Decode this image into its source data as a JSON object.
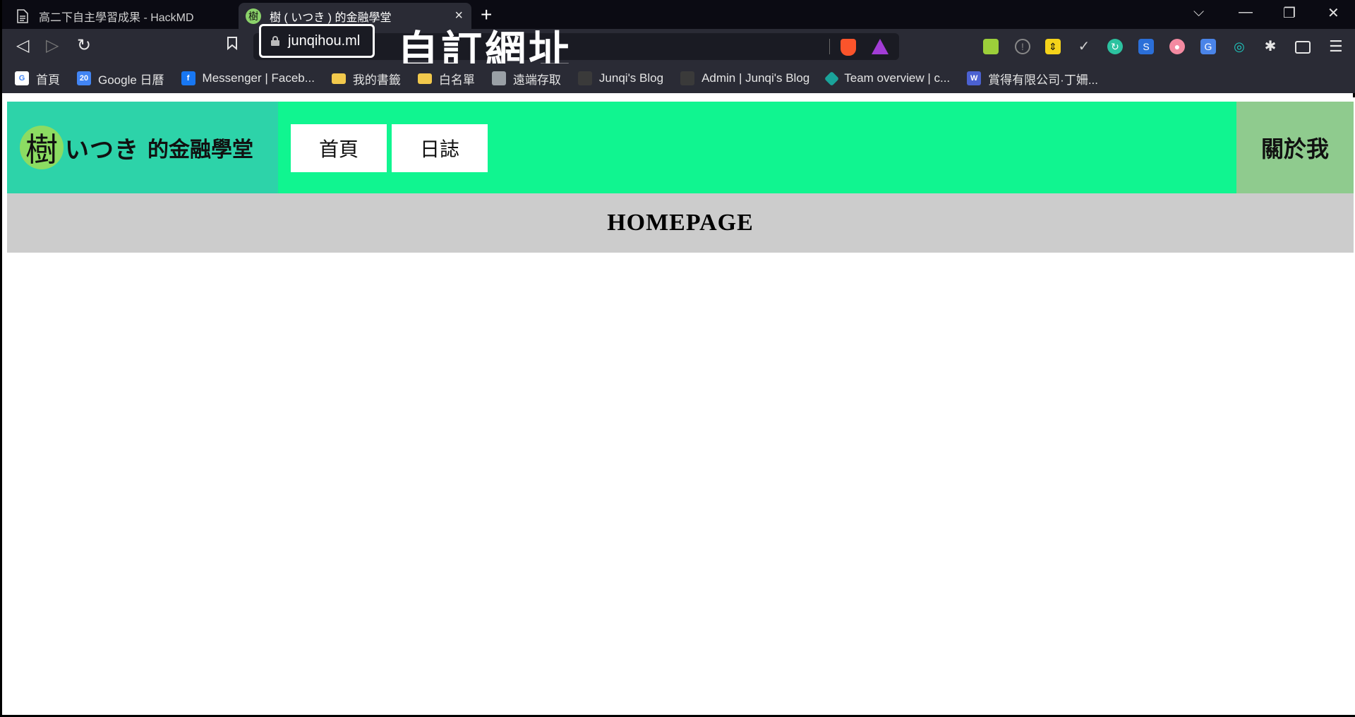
{
  "browser": {
    "tabs": [
      {
        "title": "高二下自主學習成果 - HackMD",
        "icon": "document-icon",
        "active": false
      },
      {
        "title": "樹 ( いつき ) 的金融學堂",
        "icon": "tree-favicon",
        "active": true
      }
    ],
    "tab_close": "×",
    "new_tab": "+",
    "window_controls": {
      "dropdown": "⌵",
      "minimize": "—",
      "restore": "❐",
      "close": "✕"
    }
  },
  "toolbar": {
    "back": "◁",
    "forward": "▷",
    "reload": "↻",
    "bookmark": "☐",
    "url": "junqihou.ml",
    "annotation": "自訂網址",
    "menu": "☰"
  },
  "bookmarks": [
    {
      "label": "首頁",
      "icon": "google-icon",
      "glyph": "G"
    },
    {
      "label": "Google 日曆",
      "icon": "calendar-icon",
      "glyph": "20"
    },
    {
      "label": "Messenger | Faceb...",
      "icon": "facebook-icon",
      "glyph": "f"
    },
    {
      "label": "我的書籤",
      "icon": "folder-icon",
      "glyph": ""
    },
    {
      "label": "白名單",
      "icon": "folder-icon",
      "glyph": ""
    },
    {
      "label": "遠端存取",
      "icon": "remote-desktop-icon",
      "glyph": ""
    },
    {
      "label": "Junqi's Blog",
      "icon": "blog-icon",
      "glyph": ""
    },
    {
      "label": "Admin | Junqi's Blog",
      "icon": "blog-icon",
      "glyph": ""
    },
    {
      "label": "Team overview | c...",
      "icon": "team-icon",
      "glyph": ""
    },
    {
      "label": "賞得有限公司·丁姍...",
      "icon": "word-icon",
      "glyph": "W"
    }
  ],
  "site": {
    "logo_char": "樹",
    "brand_name": "いつき",
    "brand_sub": "的金融學堂",
    "nav": [
      "首頁",
      "日誌"
    ],
    "about": "關於我",
    "hero_title": "HOMEPAGE"
  },
  "colors": {
    "header_green": "#10f590",
    "brand_teal": "#2dd3a9",
    "about_green": "#8fcb8e",
    "hero_gray": "#cccccc",
    "logo_circle": "#8cdc62"
  }
}
